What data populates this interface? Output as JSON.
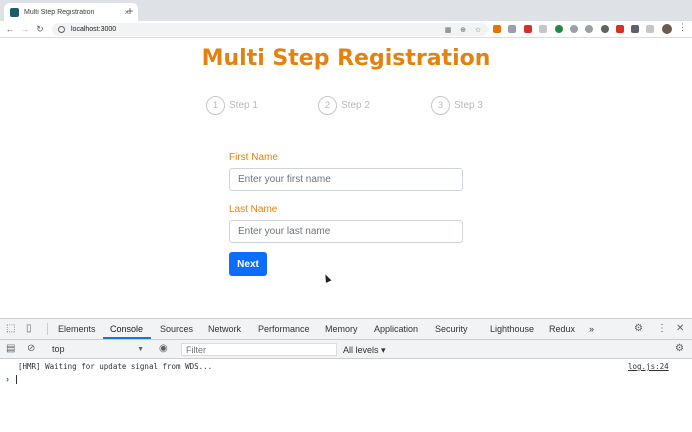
{
  "browser": {
    "tab_title": "Multi Step Registration",
    "tab_close": "×",
    "new_tab": "+",
    "url": "localhost:3000",
    "back": "←",
    "forward": "→",
    "reload": "↻",
    "kebab": "⋮"
  },
  "page": {
    "title": "Multi Step Registration",
    "steps": [
      {
        "number": "1",
        "label": "Step 1"
      },
      {
        "number": "2",
        "label": "Step 2"
      },
      {
        "number": "3",
        "label": "Step 3"
      }
    ],
    "fields": [
      {
        "label": "First Name",
        "placeholder": "Enter your first name"
      },
      {
        "label": "Last Name",
        "placeholder": "Enter your last name"
      }
    ],
    "next_label": "Next"
  },
  "devtools": {
    "tabs": [
      "Elements",
      "Console",
      "Sources",
      "Network",
      "Performance",
      "Memory",
      "Application",
      "Security",
      "Lighthouse",
      "Redux"
    ],
    "active_tab": "Console",
    "more": "»",
    "context": "top",
    "filter_placeholder": "Filter",
    "levels": "All levels ▾",
    "log_message": "[HMR] Waiting for update signal from WDS...",
    "log_source": "log.js:24",
    "prompt": "›"
  },
  "colors": {
    "accent": "#e5820e",
    "button": "#0d6efd",
    "devtools_active": "#1a73e8"
  }
}
